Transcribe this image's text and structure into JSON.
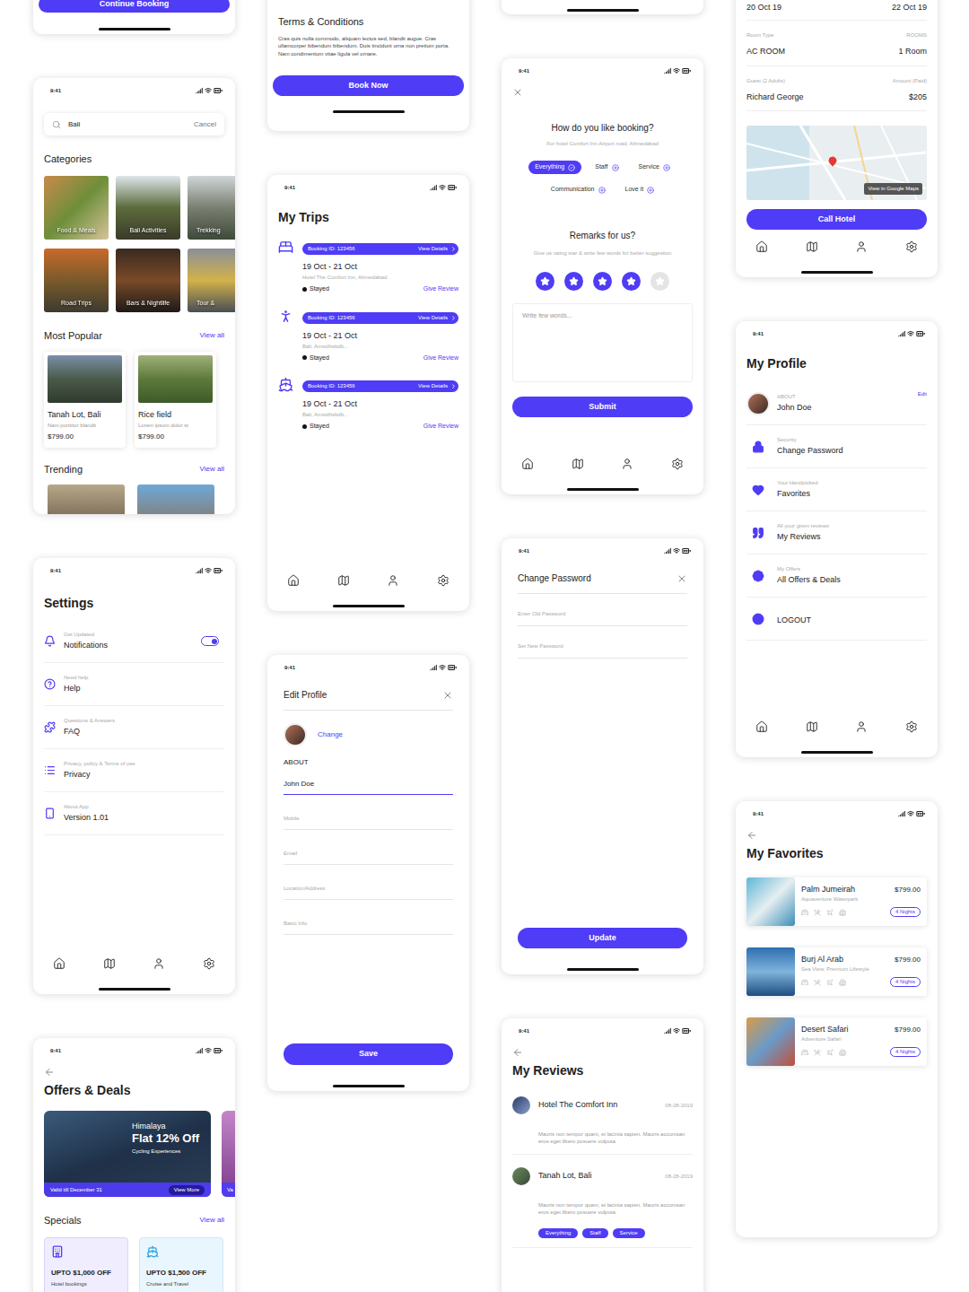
{
  "status_bar": {
    "time": "9:41"
  },
  "continue_card": {
    "button": "Continue Booking"
  },
  "terms_card": {
    "title": "Terms & Conditions",
    "body": "Cras quis nulla commodo, aliquam lectus sed, blandit augue. Cras ullamcorper bibendum bibendum. Duis tincidunt urna non pretium porta. Nam condimentum vitae ligula vel ornare.",
    "button": "Book Now"
  },
  "booking_card": {
    "check_in": "20 Oct 19",
    "check_out": "22 Oct 19",
    "rows": [
      {
        "label": "Room Type",
        "value": "AC ROOM",
        "label_right": "ROOMS",
        "value_right": "1 Room"
      },
      {
        "label": "Guest (2 Adults)",
        "value": "Richard George",
        "label_right": "Amount (Paid)",
        "value_right": "$205"
      }
    ],
    "map_button": "View in Google Maps",
    "button": "Call Hotel"
  },
  "search_screen": {
    "query": "Bali",
    "cancel": "Cancel",
    "categories_title": "Categories",
    "categories": [
      {
        "label": "Food & Meals"
      },
      {
        "label": "Bali Activities"
      },
      {
        "label": "Trekking"
      },
      {
        "label": "Road Trips"
      },
      {
        "label": "Bars & Nightlife"
      },
      {
        "label": "Tour &"
      }
    ],
    "popular_title": "Most Popular",
    "popular_link": "View all",
    "popular": [
      {
        "name": "Tanah Lot, Bali",
        "sub": "Nam porttitor blandit",
        "price": "$799.00"
      },
      {
        "name": "Rice field",
        "sub": "Lorem ipsum dolor st",
        "price": "$799.00"
      }
    ],
    "trending_title": "Trending",
    "trending_link": "View all"
  },
  "settings_screen": {
    "title": "Settings",
    "items": [
      {
        "kind": "toggle",
        "caption": "Get Updated",
        "label": "Notifications",
        "on": true
      },
      {
        "kind": "link",
        "caption": "Need help",
        "label": "Help"
      },
      {
        "kind": "link",
        "caption": "Questions & Answers",
        "label": "FAQ"
      },
      {
        "kind": "link",
        "caption": "Privacy, policy & Terms of use",
        "label": "Privacy"
      },
      {
        "kind": "link",
        "caption": "About App",
        "label": "Version 1.01"
      }
    ]
  },
  "offers_screen": {
    "title": "Offers & Deals",
    "banners": [
      {
        "place": "Himalaya",
        "offer": "Flat 12% Off",
        "subtitle": "Cycling Experiences",
        "valid": "Valid till December 31",
        "button": "View More"
      },
      {
        "valid": "Va"
      }
    ],
    "specials_title": "Specials",
    "specials_link": "View all",
    "specials": [
      {
        "offer": "UPTO $1,000 OFF",
        "sub": "Hotel bookings"
      },
      {
        "offer": "UPTO $1,500 OFF",
        "sub": "Cruise and Travel"
      }
    ]
  },
  "trips_screen": {
    "title": "My Trips",
    "trips": [
      {
        "booking_id": "Booking ID: 123456",
        "details": "View Details",
        "dates": "19 Oct - 21 Oct",
        "place": "Hotel The Comfort Inn, Ahmedabad",
        "status": "Stayed",
        "action": "Give Review"
      },
      {
        "booking_id": "Booking ID: 123456",
        "details": "View Details",
        "dates": "19 Oct - 21 Oct",
        "place": "Bali, Amsidhsbdb...",
        "status": "Stayed",
        "action": "Give Review"
      },
      {
        "booking_id": "Booking ID: 123456",
        "details": "View Details",
        "dates": "19 Oct - 21 Oct",
        "place": "Bali, Amsidhsbdb...",
        "status": "Stayed",
        "action": "Give Review"
      }
    ]
  },
  "edit_profile_screen": {
    "title": "Edit Profile",
    "change": "Change",
    "section": "ABOUT",
    "name": "John Doe",
    "fields": [
      "Mobile",
      "Email",
      "Location/Address",
      "Basic Info"
    ],
    "button": "Save"
  },
  "review_screen": {
    "title": "How do you like booking?",
    "subtitle": "For hotel Comfort Inn Airport road, Ahmedabad",
    "chips": [
      {
        "label": "Everything",
        "selected": true
      },
      {
        "label": "Staff",
        "selected": false
      },
      {
        "label": "Service",
        "selected": false
      },
      {
        "label": "Communication",
        "selected": false
      },
      {
        "label": "Love it",
        "selected": false
      }
    ],
    "remarks_title": "Remarks for us?",
    "remarks_subtitle": "Give us rating star & write few words for better suggestion",
    "stars": 4,
    "max_stars": 5,
    "placeholder": "Write few words...",
    "button": "Submit"
  },
  "change_password_screen": {
    "title": "Change Password",
    "fields": [
      "Enter Old Password",
      "Set New Password"
    ],
    "button": "Update"
  },
  "reviews_screen": {
    "title": "My Reviews",
    "reviews": [
      {
        "name": "Hotel The Comfort Inn",
        "date": "08-28-2019",
        "text": "Mauris non tempor quam, et lacinia sapien. Mauris accumsan eros eget libero posuere vulputa.",
        "tags": []
      },
      {
        "name": "Tanah Lot, Bali",
        "date": "08-28-2019",
        "text": "Mauris non tempor quam, et lacinia sapien. Mauris accumsan eros eget libero posuere vulputa.",
        "tags": [
          "Everything",
          "Staff",
          "Service"
        ]
      }
    ]
  },
  "profile_screen": {
    "title": "My Profile",
    "items": [
      {
        "kind": "avatar",
        "caption": "ABOUT",
        "label": "John Doe",
        "action": "Edit"
      },
      {
        "kind": "icon",
        "caption": "Security",
        "label": "Change Password"
      },
      {
        "kind": "icon",
        "caption": "Your Handpicked",
        "label": "Favorites"
      },
      {
        "kind": "icon",
        "caption": "All your given reviews",
        "label": "My Reviews"
      },
      {
        "kind": "icon",
        "caption": "My Offers",
        "label": "All Offers & Deals"
      },
      {
        "kind": "icon",
        "label": "LOGOUT"
      }
    ]
  },
  "favorites_screen": {
    "title": "My Favorites",
    "items": [
      {
        "name": "Palm Jumeirah",
        "price": "$799.00",
        "sub": "Aquaventure Waterpark",
        "nights": "4 Nights"
      },
      {
        "name": "Burj Al Arab",
        "price": "$799.00",
        "sub": "Sea View, Premium Lifestyle",
        "nights": "4 Nights"
      },
      {
        "name": "Desert Safari",
        "price": "$799.00",
        "sub": "Adventure Safari",
        "nights": "4 Nights"
      }
    ]
  }
}
